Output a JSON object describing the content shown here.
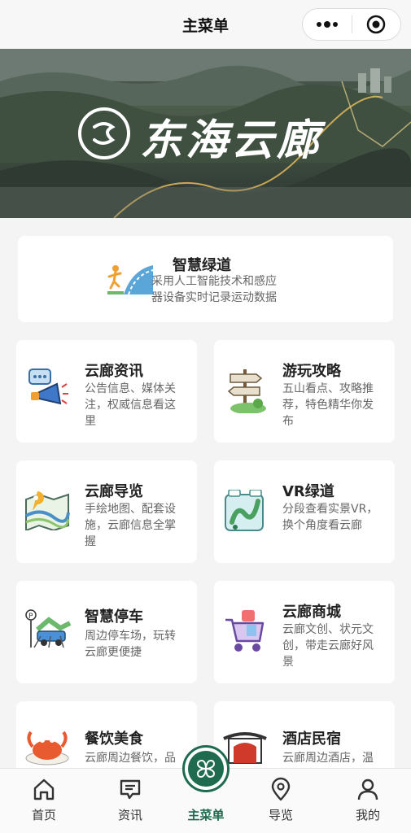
{
  "navbar": {
    "title": "主菜单"
  },
  "banner": {
    "brand": "东海云廊"
  },
  "hero_card": {
    "title": "智慧绿道",
    "desc": "采用人工智能技术和感应器设备实时记录运动数据"
  },
  "cards": [
    {
      "title": "云廊资讯",
      "desc": "公告信息、媒体关注，权威信息看这里"
    },
    {
      "title": "游玩攻略",
      "desc": "五山看点、攻略推荐，特色精华你发布"
    },
    {
      "title": "云廊导览",
      "desc": "手绘地图、配套设施，云廊信息全掌握"
    },
    {
      "title": "VR绿道",
      "desc": "分段查看实景VR，换个角度看云廊"
    },
    {
      "title": "智慧停车",
      "desc": "周边停车场，玩转云廊更便捷"
    },
    {
      "title": "云廊商城",
      "desc": "云廊文创、状元文创，带走云廊好风景"
    },
    {
      "title": "餐饮美食",
      "desc": "云廊周边餐饮，品"
    },
    {
      "title": "酒店民宿",
      "desc": "云廊周边酒店，温"
    }
  ],
  "tabs": [
    {
      "label": "首页",
      "icon": "home-icon"
    },
    {
      "label": "资讯",
      "icon": "message-icon"
    },
    {
      "label": "主菜单",
      "icon": "menu-icon"
    },
    {
      "label": "导览",
      "icon": "location-icon"
    },
    {
      "label": "我的",
      "icon": "user-icon"
    }
  ],
  "colors": {
    "accent": "#1e6b4f"
  }
}
